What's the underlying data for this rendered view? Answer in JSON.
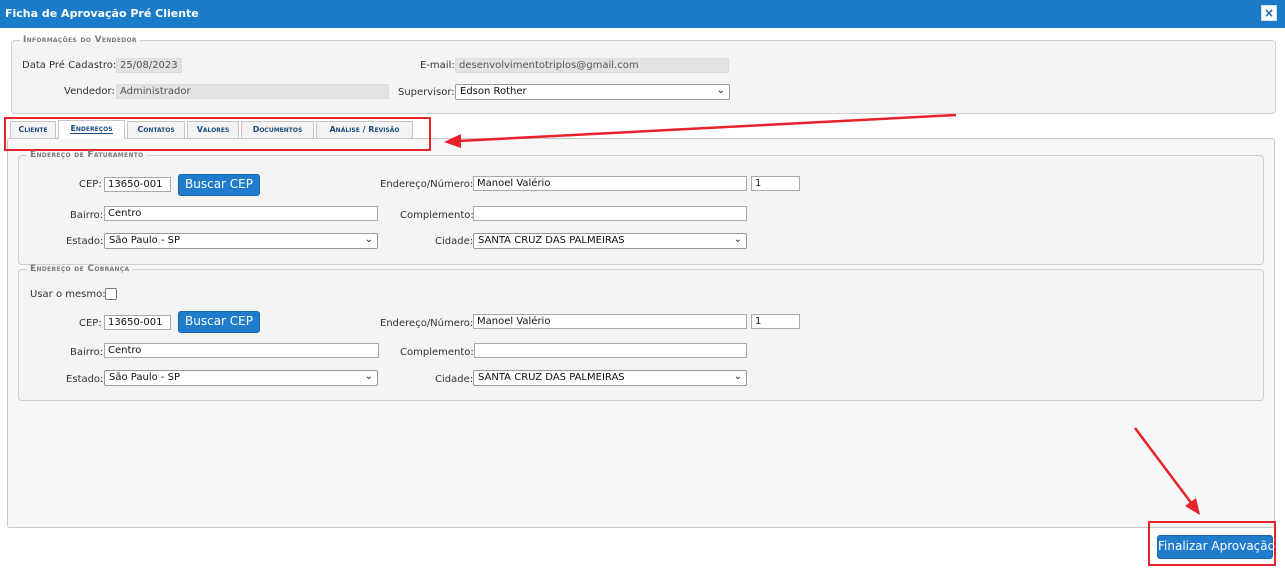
{
  "window": {
    "title": "Ficha de Aprovação Pré Cliente",
    "close_symbol": "×"
  },
  "vendedor": {
    "legend": "Informações do Vendedor",
    "data_cadastro_label": "Data Pré Cadastro:",
    "data_cadastro_value": "25/08/2023",
    "email_label": "E-mail:",
    "email_value": "desenvolvimentotriplos@gmail.com",
    "vendedor_label": "Vendedor:",
    "vendedor_value": "Administrador",
    "supervisor_label": "Supervisor:",
    "supervisor_value": "Edson Rother"
  },
  "tabs": [
    {
      "label": "Cliente"
    },
    {
      "label": "Endereços",
      "active": true
    },
    {
      "label": "Contatos"
    },
    {
      "label": "Valores"
    },
    {
      "label": "Documentos"
    },
    {
      "label": "Análise / Revisão"
    }
  ],
  "faturamento": {
    "legend": "Endereço de Faturamento",
    "cep_label": "CEP:",
    "cep_value": "13650-001",
    "buscar_label": "Buscar CEP",
    "endereco_label": "Endereço/Número:",
    "endereco_value": "Manoel Valério",
    "numero_value": "1",
    "bairro_label": "Bairro:",
    "bairro_value": "Centro",
    "complemento_label": "Complemento:",
    "complemento_value": "",
    "estado_label": "Estado:",
    "estado_value": "São Paulo - SP",
    "cidade_label": "Cidade:",
    "cidade_value": "SANTA CRUZ DAS PALMEIRAS"
  },
  "cobranca": {
    "legend": "Endereço de Cobrança",
    "usar_mesmo_label": "Usar o mesmo:",
    "usar_mesmo_checked": false,
    "cep_label": "CEP:",
    "cep_value": "13650-001",
    "buscar_label": "Buscar CEP",
    "endereco_label": "Endereço/Número:",
    "endereco_value": "Manoel Valério",
    "numero_value": "1",
    "bairro_label": "Bairro:",
    "bairro_value": "Centro",
    "complemento_label": "Complemento:",
    "complemento_value": "",
    "estado_label": "Estado:",
    "estado_value": "São Paulo - SP",
    "cidade_label": "Cidade:",
    "cidade_value": "SANTA CRUZ DAS PALMEIRAS"
  },
  "footer": {
    "finalizar_label": "Finalizar Aprovação"
  },
  "colors": {
    "titlebar": "#1a7bc9",
    "button": "#1f7ccd",
    "annotation_red": "#e8222a",
    "tab_text": "#1b4d7e"
  },
  "icons": {
    "close": "close-icon",
    "dropdown": "chevron-down-icon",
    "annotation": "arrow-icon"
  }
}
